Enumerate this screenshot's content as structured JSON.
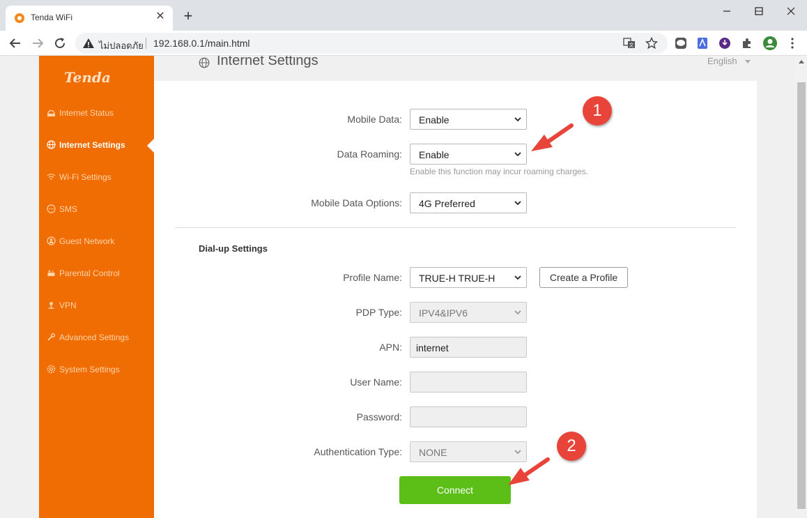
{
  "browser": {
    "tab_title": "Tenda WiFi",
    "insecure_label": "ไม่ปลอดภัย",
    "url": "192.168.0.1/main.html"
  },
  "app": {
    "logo": "Tenda",
    "page_title": "Internet Settings",
    "language": "English",
    "accent_color": "#ef6d02",
    "connect_color": "#5cbf18"
  },
  "sidebar": {
    "items": [
      {
        "label": "Internet Status",
        "icon": "router-icon"
      },
      {
        "label": "Internet Settings",
        "icon": "globe-icon",
        "active": true
      },
      {
        "label": "Wi-Fi Settings",
        "icon": "wifi-icon"
      },
      {
        "label": "SMS",
        "icon": "sms-icon"
      },
      {
        "label": "Guest Network",
        "icon": "guest-icon"
      },
      {
        "label": "Parental Control",
        "icon": "parental-icon"
      },
      {
        "label": "VPN",
        "icon": "vpn-icon"
      },
      {
        "label": "Advanced Settings",
        "icon": "tools-icon"
      },
      {
        "label": "System Settings",
        "icon": "gear-icon"
      }
    ]
  },
  "form": {
    "mobile_data": {
      "label": "Mobile Data:",
      "value": "Enable"
    },
    "data_roaming": {
      "label": "Data Roaming:",
      "value": "Enable",
      "hint": "Enable this function may incur roaming charges."
    },
    "mobile_data_options": {
      "label": "Mobile Data Options:",
      "value": "4G Preferred"
    },
    "dialup_title": "Dial-up Settings",
    "profile_name": {
      "label": "Profile Name:",
      "value": "TRUE-H TRUE-H"
    },
    "create_profile": "Create a Profile",
    "pdp_type": {
      "label": "PDP Type:",
      "value": "IPV4&IPV6"
    },
    "apn": {
      "label": "APN:",
      "value": "internet"
    },
    "user_name": {
      "label": "User Name:",
      "value": ""
    },
    "password": {
      "label": "Password:",
      "value": ""
    },
    "auth_type": {
      "label": "Authentication Type:",
      "value": "NONE"
    },
    "connect": "Connect"
  },
  "annotations": {
    "badge1": "1",
    "badge2": "2"
  }
}
